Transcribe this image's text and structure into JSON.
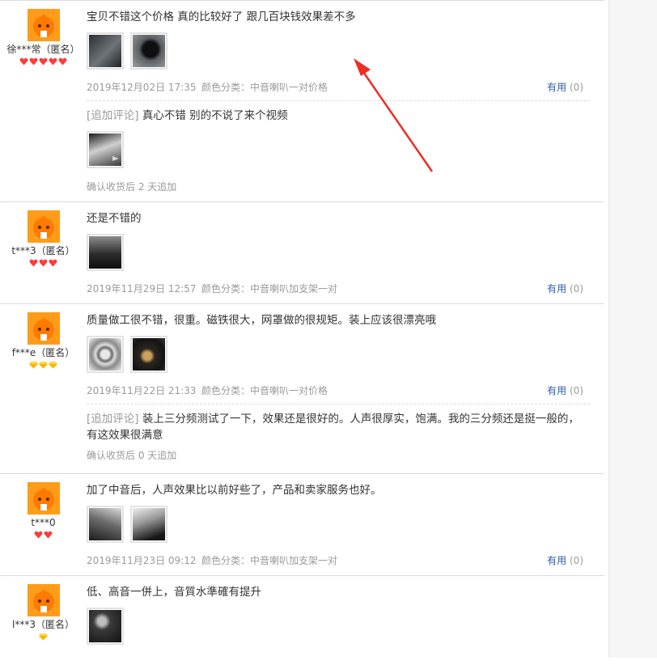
{
  "reviews": [
    {
      "text": "宝贝不错这个价格 真的比较好了 跟几百块钱效果差不多",
      "username": "徐***常（匿名）",
      "badge_type": "red",
      "badge_count": 5,
      "date": "2019年12月02日 17:35",
      "sku": "颜色分类：中音喇叭一对价格",
      "useful_label": "有用",
      "useful_count": "(0)",
      "append": {
        "tag": "[追加评论]",
        "text": " 真心不错 别的不说了来个视频",
        "note": "确认收货后 2 天追加"
      }
    },
    {
      "text": "还是不错的",
      "username": "t***3（匿名）",
      "badge_type": "red",
      "badge_count": 3,
      "date": "2019年11月29日 12:57",
      "sku": "颜色分类：中音喇叭加支架一对",
      "useful_label": "有用",
      "useful_count": "(0)"
    },
    {
      "text": "质量做工很不错，很重。磁铁很大，网罩做的很规矩。装上应该很漂亮哦",
      "username": "f***e（匿名）",
      "badge_type": "gold",
      "badge_count": 3,
      "date": "2019年11月22日 21:33",
      "sku": "颜色分类：中音喇叭一对价格",
      "useful_label": "有用",
      "useful_count": "(0)",
      "append": {
        "tag": "[追加评论]",
        "text": " 装上三分频测试了一下，效果还是很好的。人声很厚实，饱满。我的三分频还是挺一般的，有这效果很满意",
        "note": "确认收货后 0 天追加"
      }
    },
    {
      "text": "加了中音后，人声效果比以前好些了，产品和卖家服务也好。",
      "username": "t***0",
      "badge_type": "red",
      "badge_count": 2,
      "date": "2019年11月23日 09:12",
      "sku": "颜色分类：中音喇叭加支架一对",
      "useful_label": "有用",
      "useful_count": "(0)"
    },
    {
      "text": "低、高音一併上，音質水準確有提升",
      "username": "l***3（匿名）",
      "badge_type": "gold",
      "badge_count": 1
    }
  ]
}
